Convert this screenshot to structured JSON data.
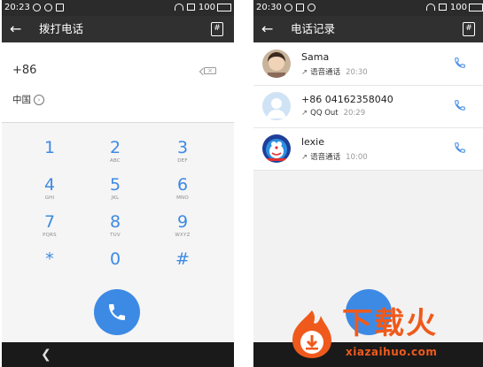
{
  "left_screen": {
    "status": {
      "time": "20:23",
      "battery": "100"
    },
    "appbar": {
      "back_icon": "arrow-left-icon",
      "title": "拨打电话",
      "action_icon": "dialpad-icon"
    },
    "number": "+86",
    "country": "中国",
    "keys": [
      {
        "digit": "1",
        "letters": ""
      },
      {
        "digit": "2",
        "letters": "ABC"
      },
      {
        "digit": "3",
        "letters": "DEF"
      },
      {
        "digit": "4",
        "letters": "GHI"
      },
      {
        "digit": "5",
        "letters": "JKL"
      },
      {
        "digit": "6",
        "letters": "MNO"
      },
      {
        "digit": "7",
        "letters": "PQRS"
      },
      {
        "digit": "8",
        "letters": "TUV"
      },
      {
        "digit": "9",
        "letters": "WXYZ"
      },
      {
        "digit": "*",
        "letters": ""
      },
      {
        "digit": "0",
        "letters": ""
      },
      {
        "digit": "#",
        "letters": ""
      }
    ],
    "call_icon": "phone-icon",
    "nav_back_icon": "chevron-left-icon"
  },
  "right_screen": {
    "status": {
      "time": "20:30",
      "battery": "100"
    },
    "appbar": {
      "back_icon": "arrow-left-icon",
      "title": "电话记录",
      "action_icon": "dialpad-icon"
    },
    "records": [
      {
        "name": "Sama",
        "direction_icon": "outgoing-arrow-icon",
        "type": "语音通话",
        "time": "20:30",
        "avatar": "photo-avatar"
      },
      {
        "name": "+86 04162358040",
        "direction_icon": "outgoing-arrow-icon",
        "type": "QQ Out",
        "time": "20:29",
        "avatar": "default-avatar"
      },
      {
        "name": "lexie",
        "direction_icon": "outgoing-arrow-icon",
        "type": "语音通话",
        "time": "10:00",
        "avatar": "doraemon-avatar"
      }
    ]
  },
  "watermark": {
    "brand": "下载火",
    "url": "xiazaihuo.com"
  },
  "colors": {
    "accent": "#3d8ae5",
    "appbar": "#303030",
    "statusbar": "#2b2b2b",
    "watermark": "#ef5a1c"
  }
}
